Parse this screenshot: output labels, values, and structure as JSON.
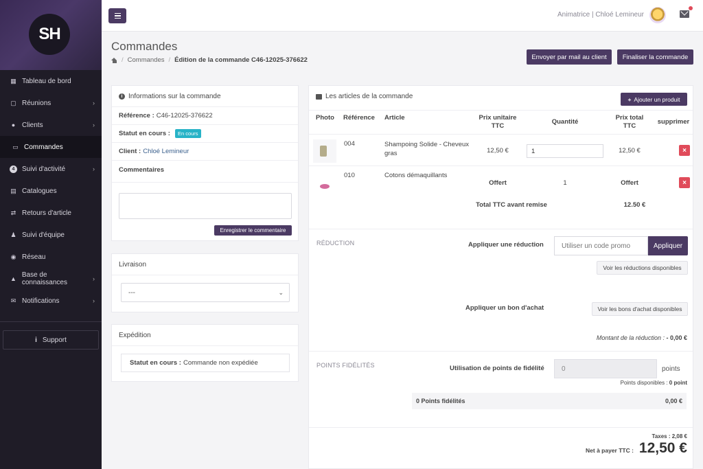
{
  "brand": {
    "logo_text": "SH"
  },
  "sidebar": {
    "items": [
      {
        "label": "Tableau de bord",
        "icon": "dashboard-icon"
      },
      {
        "label": "Réunions",
        "icon": "calendar-icon"
      },
      {
        "label": "Clients",
        "icon": "users-icon"
      },
      {
        "label": "Commandes",
        "icon": "card-icon"
      },
      {
        "label": "Suivi d'activité",
        "icon": "badge-icon",
        "badge": "4"
      },
      {
        "label": "Catalogues",
        "icon": "book-icon"
      },
      {
        "label": "Retours d'article",
        "icon": "exchange-icon"
      },
      {
        "label": "Suivi d'équipe",
        "icon": "team-icon"
      },
      {
        "label": "Réseau",
        "icon": "globe-icon"
      },
      {
        "label": "Base de connaissances",
        "icon": "graduation-icon"
      },
      {
        "label": "Notifications",
        "icon": "envelope-icon"
      }
    ],
    "support_label": "Support"
  },
  "topbar": {
    "user_label": "Animatrice | Chloé Lemineur"
  },
  "header": {
    "title": "Commandes",
    "breadcrumb": [
      "Commandes",
      "Édition de la commande C46-12025-376622"
    ],
    "btn_email": "Envoyer par mail au client",
    "btn_finalize": "Finaliser la commande"
  },
  "order_info": {
    "title": "Informations sur la commande",
    "reference_label": "Référence :",
    "reference_value": "C46-12025-376622",
    "status_label": "Statut en cours :",
    "status_value": "En cours",
    "client_label": "Client :",
    "client_value": "Chloé Lemineur",
    "comments_label": "Commentaires",
    "save_comment_label": "Enregistrer le commentaire"
  },
  "delivery": {
    "title": "Livraison",
    "selected": "---"
  },
  "shipping": {
    "title": "Expédition",
    "status_label": "Statut en cours :",
    "status_value": "Commande non expédiée"
  },
  "articles": {
    "title": "Les articles de la commande",
    "add_label": "Ajouter un produit",
    "headers": {
      "photo": "Photo",
      "reference": "Référence",
      "article": "Article",
      "unit_price": "Prix unitaire TTC",
      "quantity": "Quantité",
      "total_price": "Prix total TTC",
      "delete": "supprimer"
    },
    "rows": [
      {
        "reference": "004",
        "article": "Shampoing Solide - Cheveux gras",
        "unit_price": "12,50 €",
        "quantity": "1",
        "total": "12,50 €"
      },
      {
        "reference": "010",
        "article": "Cotons démaquillants",
        "unit_price": "Offert",
        "quantity": "1",
        "total": "Offert"
      }
    ],
    "subtotal_label": "Total TTC avant remise",
    "subtotal_value": "12.50 €"
  },
  "reduction": {
    "section_label": "RÉDUCTION",
    "apply_reduction_label": "Appliquer une réduction",
    "promo_placeholder": "Utiliser un code promo",
    "apply_button": "Appliquer",
    "see_reductions": "Voir les réductions disponibles",
    "voucher_label": "Appliquer un bon d'achat",
    "see_vouchers": "Voir les bons d'achat disponibles",
    "amount_text": "Montant de la réduction :",
    "amount_value": "- 0,00 €"
  },
  "loyalty": {
    "section_label": "POINTS FIDÉLITÉS",
    "usage_label": "Utilisation de points de fidélité",
    "points_value": "0",
    "points_unit": "points",
    "available_text": "Points disponibles :",
    "available_value": "0 point",
    "summary_label": "0 Points fidélités",
    "summary_value": "0,00 €"
  },
  "totals": {
    "taxes_label": "Taxes :",
    "taxes_value": "2,08 €",
    "net_label": "Net à payer TTC :",
    "net_value": "12,50 €"
  },
  "colors": {
    "primary": "#4b3a63",
    "danger": "#e04b5a",
    "info": "#28b3c7"
  }
}
